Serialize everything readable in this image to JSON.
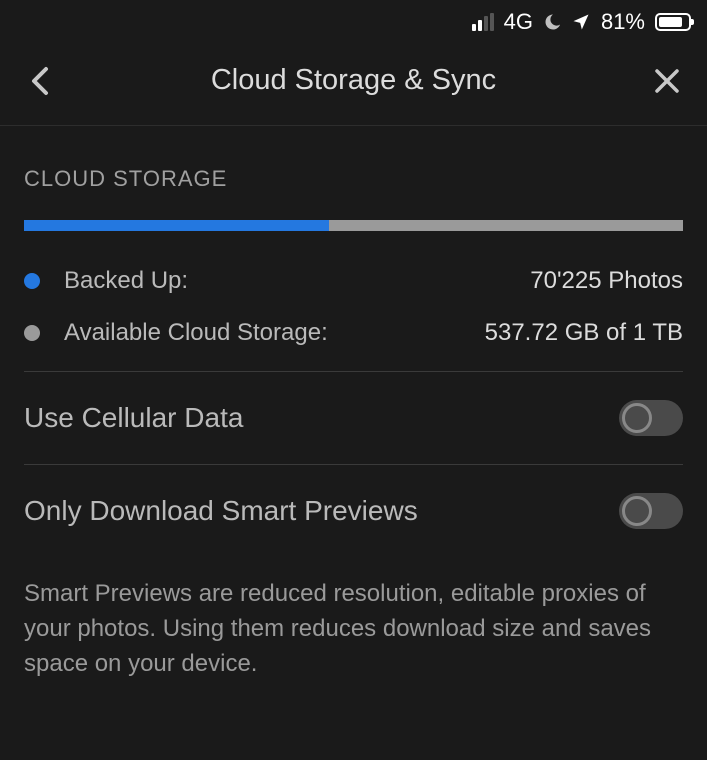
{
  "status_bar": {
    "network_type": "4G",
    "battery_percent": "81%",
    "battery_fill_width": "81%"
  },
  "header": {
    "title": "Cloud Storage & Sync"
  },
  "storage_section": {
    "title": "CLOUD STORAGE",
    "progress_percent": "46.3%",
    "backed_up": {
      "label": "Backed Up:",
      "value": "70'225 Photos"
    },
    "available": {
      "label": "Available Cloud Storage:",
      "value": "537.72 GB of 1 TB"
    }
  },
  "settings": {
    "cellular": {
      "label": "Use Cellular Data",
      "enabled": false
    },
    "smart_previews": {
      "label": "Only Download Smart Previews",
      "enabled": false,
      "description": "Smart Previews are reduced resolution, editable proxies of your photos. Using them reduces download size and saves space on your device."
    }
  }
}
